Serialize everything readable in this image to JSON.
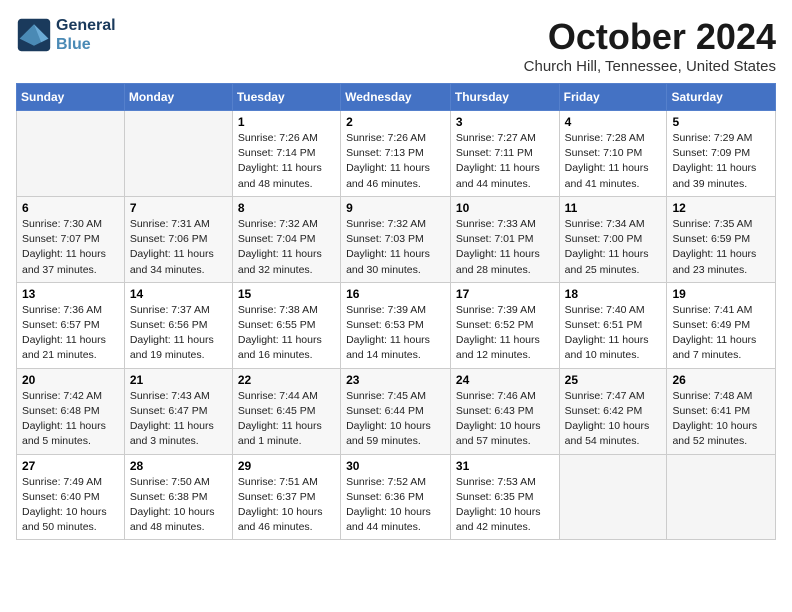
{
  "header": {
    "logo_line1": "General",
    "logo_line2": "Blue",
    "month": "October 2024",
    "location": "Church Hill, Tennessee, United States"
  },
  "days_of_week": [
    "Sunday",
    "Monday",
    "Tuesday",
    "Wednesday",
    "Thursday",
    "Friday",
    "Saturday"
  ],
  "weeks": [
    [
      {
        "num": "",
        "data": "",
        "empty": true
      },
      {
        "num": "",
        "data": "",
        "empty": true
      },
      {
        "num": "1",
        "data": "Sunrise: 7:26 AM\nSunset: 7:14 PM\nDaylight: 11 hours and 48 minutes."
      },
      {
        "num": "2",
        "data": "Sunrise: 7:26 AM\nSunset: 7:13 PM\nDaylight: 11 hours and 46 minutes."
      },
      {
        "num": "3",
        "data": "Sunrise: 7:27 AM\nSunset: 7:11 PM\nDaylight: 11 hours and 44 minutes."
      },
      {
        "num": "4",
        "data": "Sunrise: 7:28 AM\nSunset: 7:10 PM\nDaylight: 11 hours and 41 minutes."
      },
      {
        "num": "5",
        "data": "Sunrise: 7:29 AM\nSunset: 7:09 PM\nDaylight: 11 hours and 39 minutes."
      }
    ],
    [
      {
        "num": "6",
        "data": "Sunrise: 7:30 AM\nSunset: 7:07 PM\nDaylight: 11 hours and 37 minutes."
      },
      {
        "num": "7",
        "data": "Sunrise: 7:31 AM\nSunset: 7:06 PM\nDaylight: 11 hours and 34 minutes."
      },
      {
        "num": "8",
        "data": "Sunrise: 7:32 AM\nSunset: 7:04 PM\nDaylight: 11 hours and 32 minutes."
      },
      {
        "num": "9",
        "data": "Sunrise: 7:32 AM\nSunset: 7:03 PM\nDaylight: 11 hours and 30 minutes."
      },
      {
        "num": "10",
        "data": "Sunrise: 7:33 AM\nSunset: 7:01 PM\nDaylight: 11 hours and 28 minutes."
      },
      {
        "num": "11",
        "data": "Sunrise: 7:34 AM\nSunset: 7:00 PM\nDaylight: 11 hours and 25 minutes."
      },
      {
        "num": "12",
        "data": "Sunrise: 7:35 AM\nSunset: 6:59 PM\nDaylight: 11 hours and 23 minutes."
      }
    ],
    [
      {
        "num": "13",
        "data": "Sunrise: 7:36 AM\nSunset: 6:57 PM\nDaylight: 11 hours and 21 minutes."
      },
      {
        "num": "14",
        "data": "Sunrise: 7:37 AM\nSunset: 6:56 PM\nDaylight: 11 hours and 19 minutes."
      },
      {
        "num": "15",
        "data": "Sunrise: 7:38 AM\nSunset: 6:55 PM\nDaylight: 11 hours and 16 minutes."
      },
      {
        "num": "16",
        "data": "Sunrise: 7:39 AM\nSunset: 6:53 PM\nDaylight: 11 hours and 14 minutes."
      },
      {
        "num": "17",
        "data": "Sunrise: 7:39 AM\nSunset: 6:52 PM\nDaylight: 11 hours and 12 minutes."
      },
      {
        "num": "18",
        "data": "Sunrise: 7:40 AM\nSunset: 6:51 PM\nDaylight: 11 hours and 10 minutes."
      },
      {
        "num": "19",
        "data": "Sunrise: 7:41 AM\nSunset: 6:49 PM\nDaylight: 11 hours and 7 minutes."
      }
    ],
    [
      {
        "num": "20",
        "data": "Sunrise: 7:42 AM\nSunset: 6:48 PM\nDaylight: 11 hours and 5 minutes."
      },
      {
        "num": "21",
        "data": "Sunrise: 7:43 AM\nSunset: 6:47 PM\nDaylight: 11 hours and 3 minutes."
      },
      {
        "num": "22",
        "data": "Sunrise: 7:44 AM\nSunset: 6:45 PM\nDaylight: 11 hours and 1 minute."
      },
      {
        "num": "23",
        "data": "Sunrise: 7:45 AM\nSunset: 6:44 PM\nDaylight: 10 hours and 59 minutes."
      },
      {
        "num": "24",
        "data": "Sunrise: 7:46 AM\nSunset: 6:43 PM\nDaylight: 10 hours and 57 minutes."
      },
      {
        "num": "25",
        "data": "Sunrise: 7:47 AM\nSunset: 6:42 PM\nDaylight: 10 hours and 54 minutes."
      },
      {
        "num": "26",
        "data": "Sunrise: 7:48 AM\nSunset: 6:41 PM\nDaylight: 10 hours and 52 minutes."
      }
    ],
    [
      {
        "num": "27",
        "data": "Sunrise: 7:49 AM\nSunset: 6:40 PM\nDaylight: 10 hours and 50 minutes."
      },
      {
        "num": "28",
        "data": "Sunrise: 7:50 AM\nSunset: 6:38 PM\nDaylight: 10 hours and 48 minutes."
      },
      {
        "num": "29",
        "data": "Sunrise: 7:51 AM\nSunset: 6:37 PM\nDaylight: 10 hours and 46 minutes."
      },
      {
        "num": "30",
        "data": "Sunrise: 7:52 AM\nSunset: 6:36 PM\nDaylight: 10 hours and 44 minutes."
      },
      {
        "num": "31",
        "data": "Sunrise: 7:53 AM\nSunset: 6:35 PM\nDaylight: 10 hours and 42 minutes."
      },
      {
        "num": "",
        "data": "",
        "empty": true
      },
      {
        "num": "",
        "data": "",
        "empty": true
      }
    ]
  ]
}
